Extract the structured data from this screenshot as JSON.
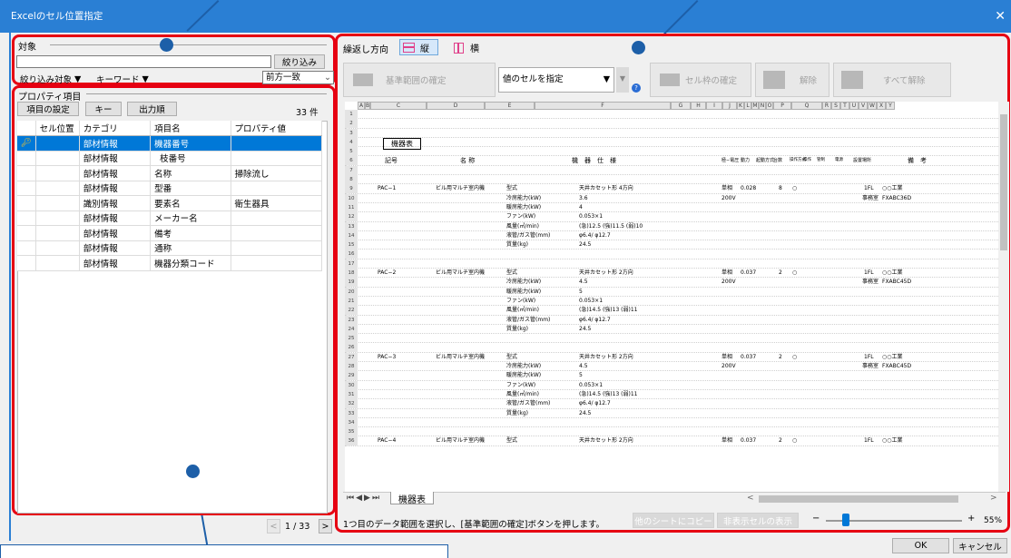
{
  "window": {
    "title": "Excelのセル位置指定",
    "close_glyph": "✕"
  },
  "target": {
    "label": "対象",
    "filter_button": "絞り込み",
    "filter_target_label": "絞り込み対象",
    "keyword_label": "キーワード",
    "match_mode": "前方一致"
  },
  "props": {
    "label": "プロパティ項目",
    "buttons": {
      "settings": "項目の設定",
      "key": "キー",
      "output_order": "出力順"
    },
    "count": "33 件",
    "columns": [
      "セル位置",
      "カテゴリ",
      "項目名",
      "プロパティ値"
    ],
    "rows": [
      {
        "cell": "",
        "category": "部材情報",
        "name": "機器番号",
        "value": "",
        "key": true
      },
      {
        "cell": "",
        "category": "部材情報",
        "name": "枝番号",
        "value": "",
        "key": false
      },
      {
        "cell": "",
        "category": "部材情報",
        "name": "名称",
        "value": "掃除流し",
        "key": false
      },
      {
        "cell": "",
        "category": "部材情報",
        "name": "型番",
        "value": "",
        "key": false
      },
      {
        "cell": "",
        "category": "識別情報",
        "name": "要素名",
        "value": "衛生器具",
        "key": false
      },
      {
        "cell": "",
        "category": "部材情報",
        "name": "メーカー名",
        "value": "",
        "key": false
      },
      {
        "cell": "",
        "category": "部材情報",
        "name": "備考",
        "value": "",
        "key": false
      },
      {
        "cell": "",
        "category": "部材情報",
        "name": "通称",
        "value": "",
        "key": false
      },
      {
        "cell": "",
        "category": "部材情報",
        "name": "機器分類コード",
        "value": "",
        "key": false
      }
    ],
    "pager": "1 / 33"
  },
  "toolbar": {
    "repeat_label": "繰返し方向",
    "vertical": "縦",
    "horizontal": "横",
    "confirm_range": "基準範囲の確定",
    "cell_value_select": "値のセルを指定",
    "confirm_cell_frame": "セル枠の確定",
    "release": "解除",
    "release_all": "すべて解除"
  },
  "sheet": {
    "col_headers": [
      "A",
      "B",
      "C",
      "D",
      "E",
      "F",
      "G",
      "H",
      "I",
      "J",
      "K",
      "L",
      "M",
      "N",
      "O",
      "P",
      "Q",
      "R",
      "S",
      "T",
      "U",
      "V",
      "W",
      "X",
      "Y"
    ],
    "title_cell": "機器表",
    "headers": [
      "記号",
      "名 称",
      "機　器　仕　様",
      "極−電圧",
      "動力",
      "起動方式",
      "台数",
      "操作方式",
      "操作",
      "管制",
      "電源",
      "設置場所",
      "備　考"
    ],
    "blocks": [
      {
        "id": "PAC−1",
        "name": "ビル用マルチ室内機",
        "type": "天井カセット形 4方向",
        "phase": "単相",
        "voltage": "200V",
        "power": "0.028",
        "qty": "8",
        "mark": "○",
        "floor": "1FL",
        "room": "事務室",
        "maker": "○○工業",
        "model": "FXABC36D",
        "specs": [
          [
            "冷房能力(kW)",
            "3.6"
          ],
          [
            "暖房能力(kW)",
            "4"
          ],
          [
            "ファン(kW)",
            "0.053×1"
          ],
          [
            "風量(㎥/min)",
            "(急)12.5 (強)11.5 (弱)10"
          ],
          [
            "液管/ガス管(mm)",
            "φ6.4/ φ12.7"
          ],
          [
            "質量(kg)",
            "24.5"
          ]
        ]
      },
      {
        "id": "PAC−2",
        "name": "ビル用マルチ室内機",
        "type": "天井カセット形 2方向",
        "phase": "単相",
        "voltage": "200V",
        "power": "0.037",
        "qty": "2",
        "mark": "○",
        "floor": "1FL",
        "room": "事務室",
        "maker": "○○工業",
        "model": "FXABC45D",
        "specs": [
          [
            "冷房能力(kW)",
            "4.5"
          ],
          [
            "暖房能力(kW)",
            "5"
          ],
          [
            "ファン(kW)",
            "0.053×1"
          ],
          [
            "風量(㎥/min)",
            "(急)14.5 (強)13 (弱)11"
          ],
          [
            "液管/ガス管(mm)",
            "φ6.4/ φ12.7"
          ],
          [
            "質量(kg)",
            "24.5"
          ]
        ]
      },
      {
        "id": "PAC−3",
        "name": "ビル用マルチ室内機",
        "type": "天井カセット形 2方向",
        "phase": "単相",
        "voltage": "200V",
        "power": "0.037",
        "qty": "2",
        "mark": "○",
        "floor": "1FL",
        "room": "事務室",
        "maker": "○○工業",
        "model": "FXABC45D",
        "specs": [
          [
            "冷房能力(kW)",
            "4.5"
          ],
          [
            "暖房能力(kW)",
            "5"
          ],
          [
            "ファン(kW)",
            "0.053×1"
          ],
          [
            "風量(㎥/min)",
            "(急)14.5 (強)13 (弱)11"
          ],
          [
            "液管/ガス管(mm)",
            "φ6.4/ φ12.7"
          ],
          [
            "質量(kg)",
            "24.5"
          ]
        ]
      },
      {
        "id": "PAC−4",
        "name": "ビル用マルチ室内機",
        "type": "天井カセット形 2方向",
        "phase": "単相",
        "voltage": "",
        "power": "0.037",
        "qty": "2",
        "mark": "○",
        "floor": "1FL",
        "room": "",
        "maker": "○○工業",
        "model": "",
        "specs": []
      }
    ],
    "tab": "機器表"
  },
  "status": {
    "message": "1つ目のデータ範囲を選択し、[基準範囲の確定]ボタンを押します。",
    "copy_other_sheet": "他のシートにコピー",
    "show_hidden": "非表示セルの表示",
    "zoom_minus": "−",
    "zoom_plus": "+",
    "zoom": "55%"
  },
  "footer": {
    "ok": "OK",
    "cancel": "キャンセル"
  },
  "colors": {
    "accent": "#2a7fd4",
    "highlight": "#e60012",
    "selection": "#0078d7",
    "callout": "#1d5fa8"
  }
}
